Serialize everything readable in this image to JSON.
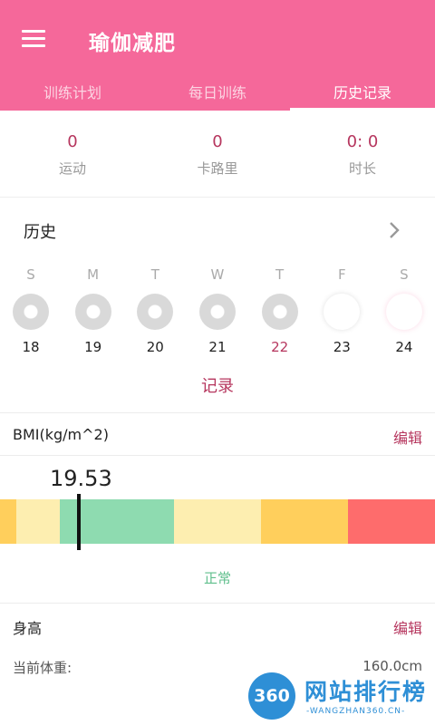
{
  "app": {
    "title": "瑜伽减肥"
  },
  "tabs": [
    {
      "label": "训练计划"
    },
    {
      "label": "每日训练"
    },
    {
      "label": "历史记录"
    }
  ],
  "stats": [
    {
      "value": "0",
      "label": "运动"
    },
    {
      "value": "0",
      "label": "卡路里"
    },
    {
      "value": "0: 0",
      "label": "时长"
    }
  ],
  "history": {
    "title": "历史",
    "days": [
      {
        "letter": "S",
        "date": "18"
      },
      {
        "letter": "M",
        "date": "19"
      },
      {
        "letter": "T",
        "date": "20"
      },
      {
        "letter": "W",
        "date": "21"
      },
      {
        "letter": "T",
        "date": "22"
      },
      {
        "letter": "F",
        "date": "23"
      },
      {
        "letter": "S",
        "date": "24"
      }
    ],
    "record_label": "记录"
  },
  "bmi": {
    "title": "BMI(kg/m^2)",
    "edit_label": "编辑",
    "value": "19.53",
    "status": "正常",
    "colors": [
      "#ffcf5c",
      "#fdeeb0",
      "#8edbb0",
      "#fdeeb0",
      "#ffcf5c",
      "#fe6c6c"
    ]
  },
  "body": {
    "height_label": "身高",
    "edit_label": "编辑",
    "weight_label": "当前体重:",
    "weight_value": "160.0cm"
  },
  "watermark": {
    "badge": "360",
    "text": "网站排行榜",
    "sub": "-WANGZHAN360.CN-"
  }
}
